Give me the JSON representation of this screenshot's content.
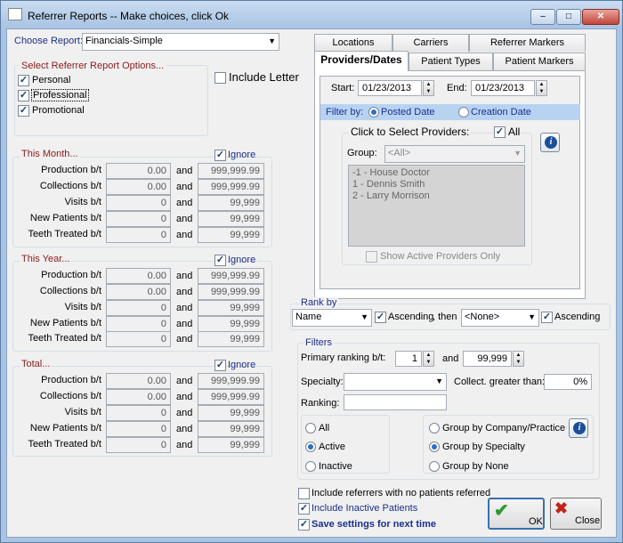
{
  "window": {
    "title": "Referrer Reports -- Make choices, click Ok",
    "min_glyph": "–",
    "max_glyph": "□",
    "close_glyph": "✕"
  },
  "report": {
    "label": "Choose Report:",
    "value": "Financials-Simple"
  },
  "options": {
    "title": "Select Referrer Report Options...",
    "personal": "Personal",
    "professional": "Professional",
    "promotional": "Promotional",
    "include_letter": "Include Letter"
  },
  "sections": {
    "month": {
      "title": "This Month...",
      "ignore": "Ignore",
      "rows": [
        {
          "label": "Production b/t",
          "from": "0.00",
          "and": "and",
          "to": "999,999.99"
        },
        {
          "label": "Collections b/t",
          "from": "0.00",
          "and": "and",
          "to": "999,999.99"
        },
        {
          "label": "Visits b/t",
          "from": "0",
          "and": "and",
          "to": "99,999"
        },
        {
          "label": "New Patients b/t",
          "from": "0",
          "and": "and",
          "to": "99,999"
        },
        {
          "label": "Teeth Treated b/t",
          "from": "0",
          "and": "and",
          "to": "99,999"
        }
      ]
    },
    "year": {
      "title": "This Year...",
      "ignore": "Ignore",
      "rows": [
        {
          "label": "Production b/t",
          "from": "0.00",
          "and": "and",
          "to": "999,999.99"
        },
        {
          "label": "Collections b/t",
          "from": "0.00",
          "and": "and",
          "to": "999,999.99"
        },
        {
          "label": "Visits b/t",
          "from": "0",
          "and": "and",
          "to": "99,999"
        },
        {
          "label": "New Patients b/t",
          "from": "0",
          "and": "and",
          "to": "99,999"
        },
        {
          "label": "Teeth Treated b/t",
          "from": "0",
          "and": "and",
          "to": "99,999"
        }
      ]
    },
    "total": {
      "title": "Total...",
      "ignore": "Ignore",
      "rows": [
        {
          "label": "Production b/t",
          "from": "0.00",
          "and": "and",
          "to": "999,999.99"
        },
        {
          "label": "Collections b/t",
          "from": "0.00",
          "and": "and",
          "to": "999,999.99"
        },
        {
          "label": "Visits b/t",
          "from": "0",
          "and": "and",
          "to": "99,999"
        },
        {
          "label": "New Patients b/t",
          "from": "0",
          "and": "and",
          "to": "99,999"
        },
        {
          "label": "Teeth Treated b/t",
          "from": "0",
          "and": "and",
          "to": "99,999"
        }
      ]
    }
  },
  "tabs": {
    "row1": [
      "Locations",
      "Carriers",
      "Referrer Markers"
    ],
    "row2": [
      "Providers/Dates",
      "Patient Types",
      "Patient Markers"
    ],
    "active": "Providers/Dates"
  },
  "dates": {
    "start_label": "Start:",
    "start_value": "01/23/2013",
    "end_label": "End:",
    "end_value": "01/23/2013"
  },
  "filter_by": {
    "label": "Filter by:",
    "posted": "Posted Date",
    "creation": "Creation Date"
  },
  "providers": {
    "title": "Click to Select Providers:",
    "all": "All",
    "group_label": "Group:",
    "group_value": "<All>",
    "list": [
      "-1 - House Doctor",
      "1 - Dennis Smith",
      "2 - Larry Morrison"
    ],
    "show_active": "Show Active Providers Only"
  },
  "rank": {
    "title": "Rank by",
    "first": "Name",
    "ascending1": "Ascending",
    "then": ", then",
    "second": "<None>",
    "ascending2": "Ascending"
  },
  "filters": {
    "title": "Filters",
    "primary_label": "Primary ranking b/t:",
    "primary_from": "1",
    "and": "and",
    "primary_to": "99,999",
    "specialty_label": "Specialty:",
    "specialty_value": "",
    "collect_label": "Collect. greater than:",
    "collect_value": "0%",
    "ranking_label": "Ranking:",
    "ranking_value": "",
    "status": [
      "All",
      "Active",
      "Inactive"
    ],
    "status_selected": "Active",
    "grouping": [
      "Group by Company/Practice",
      "Group by Specialty",
      "Group by None"
    ],
    "grouping_selected": "Group by Specialty"
  },
  "footer": {
    "no_patients": "Include referrers with no patients referred",
    "inactive": "Include Inactive Patients",
    "save": "Save settings for next time"
  },
  "buttons": {
    "ok": "OK",
    "close": "Close"
  },
  "colors": {
    "accent_blue": "#1c2f8c",
    "section_maroon": "#8b1a1a",
    "filter_band": "#b8d3f2",
    "ok_green": "#2e9a2e",
    "close_red": "#c0261c"
  }
}
